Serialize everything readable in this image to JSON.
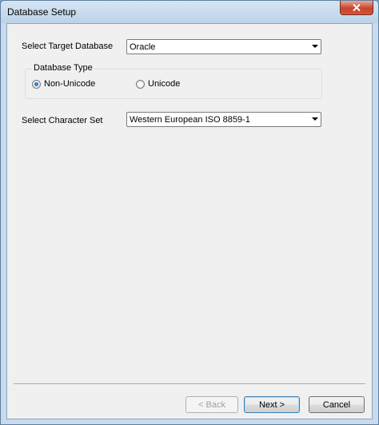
{
  "window": {
    "title": "Database Setup"
  },
  "form": {
    "target_db_label": "Select Target Database",
    "target_db_value": "Oracle",
    "db_type_legend": "Database Type",
    "radio_non_unicode": "Non-Unicode",
    "radio_unicode": "Unicode",
    "selected_db_type": "Non-Unicode",
    "charset_label": "Select Character Set",
    "charset_value": "Western European ISO 8859-1"
  },
  "buttons": {
    "back": "< Back",
    "next": "Next >",
    "cancel": "Cancel"
  },
  "icons": {
    "close": "close-icon",
    "dropdown": "chevron-down-icon"
  },
  "colors": {
    "close_button": "#c7452b",
    "accent": "#3c7fb1"
  }
}
